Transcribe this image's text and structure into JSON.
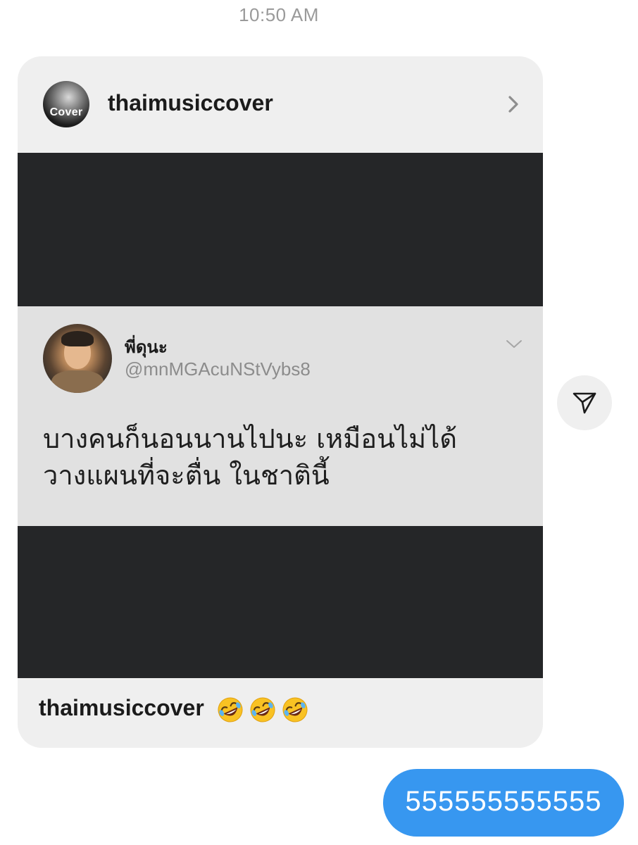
{
  "timestamp": "10:50 AM",
  "shared_post": {
    "username": "thaimusiccover",
    "avatar_text": "Cover",
    "tweet": {
      "name": "พี่ดุนะ",
      "handle": "@mnMGAcuNStVybs8",
      "text": "บางคนก็นอนนานไปนะ เหมือนไม่ได้วางแผนที่จะตื่น ในชาตินี้"
    },
    "caption_user": "thaimusiccover",
    "caption_emojis": [
      "rolling-on-floor-laughing",
      "rolling-on-floor-laughing",
      "rolling-on-floor-laughing"
    ]
  },
  "sent_message": {
    "text": "555555555555"
  },
  "icons": {
    "chevron": "chevron-right-icon",
    "share": "paper-plane-icon",
    "tweet_caret": "chevron-down-icon"
  },
  "colors": {
    "sent_bubble": "#3797f0",
    "card_background": "#efefef",
    "media_background": "#252628"
  }
}
